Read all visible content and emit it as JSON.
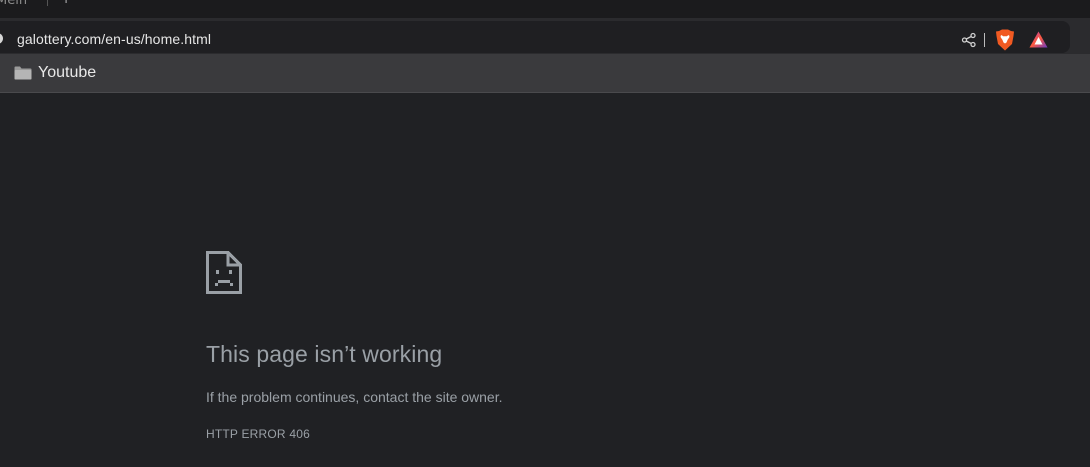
{
  "tabstrip": {
    "tab_title_fragment": "Mein",
    "new_tab_label": "+"
  },
  "toolbar": {
    "url": "galottery.com/en-us/home.html",
    "icons": [
      "info-icon",
      "share-icon",
      "brave-shields-icon",
      "brave-rewards-icon"
    ]
  },
  "bookmarks": {
    "items": [
      {
        "label": "Youtube",
        "icon": "folder-icon"
      }
    ]
  },
  "error": {
    "icon": "sad-page-icon",
    "title": "This page isn’t working",
    "message": "If the problem continues, contact the site owner.",
    "code": "HTTP ERROR 406"
  },
  "colors": {
    "page_background": "#202124",
    "toolbar": "#2b2b2e",
    "bookmarks_bar": "#3a3a3d",
    "error_text": "#9aa0a6",
    "brave_orange": "#f15a22"
  }
}
